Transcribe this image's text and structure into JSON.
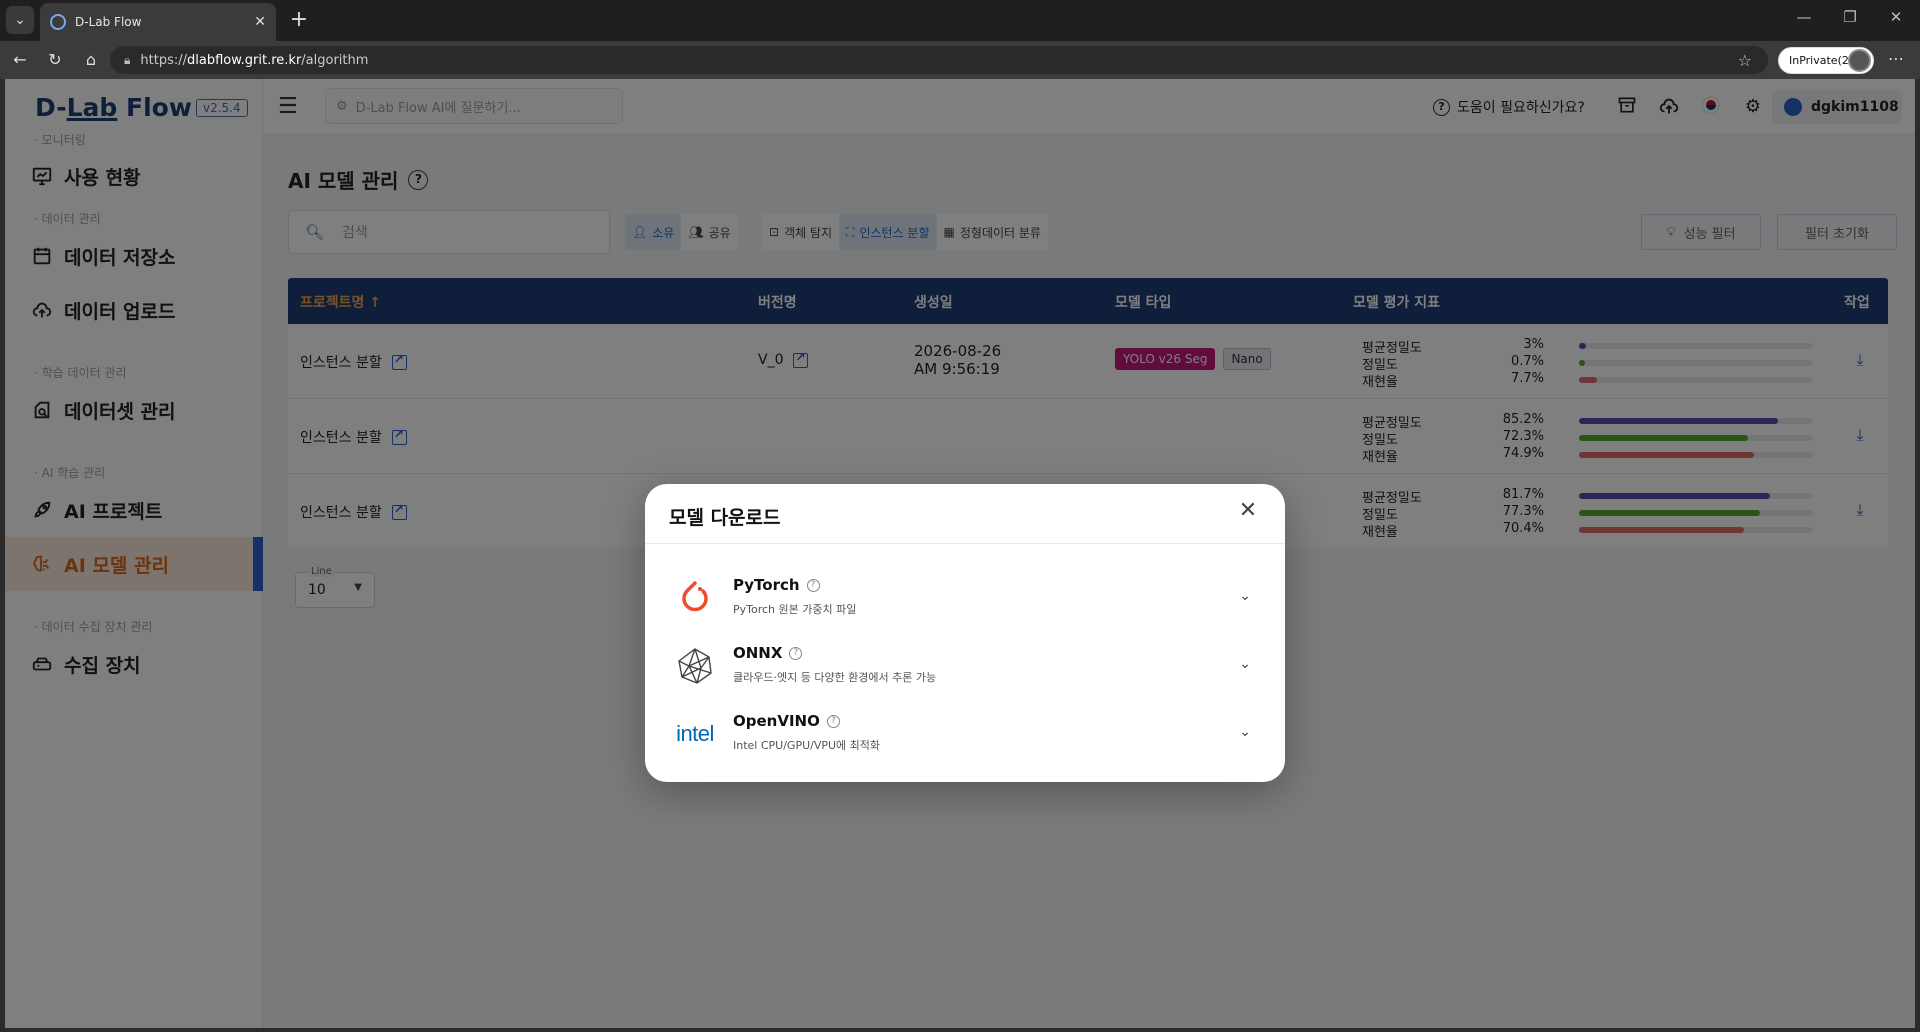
{
  "browser": {
    "tab_title": "D-Lab Flow",
    "url_scheme": "https://",
    "url_host": "dlabflow.grit.re.kr",
    "url_path": "/algorithm",
    "inprivate_label": "InPrivate(2)"
  },
  "app": {
    "logo": {
      "part1": "D-",
      "part2": "Lab",
      "part3": " Flow"
    },
    "version": "v2.5.4",
    "ai_ask_placeholder": "D-Lab Flow AI에 질문하기...",
    "help_label": "도움이 필요하신가요?",
    "username": "dgkim1108"
  },
  "sidebar": {
    "sections": [
      {
        "label": "· 모니터링"
      },
      {
        "label": "· 데이터 관리"
      },
      {
        "label": "· 학습 데이터 관리"
      },
      {
        "label": "· AI 학습 관리"
      },
      {
        "label": "· 데이터 수집 장치 관리"
      }
    ],
    "items": [
      {
        "label": "사용 현황",
        "icon": "monitor-chart-icon"
      },
      {
        "label": "데이터 저장소",
        "icon": "calendar-storage-icon"
      },
      {
        "label": "데이터 업로드",
        "icon": "cloud-upload-icon"
      },
      {
        "label": "데이터셋 관리",
        "icon": "dataset-icon"
      },
      {
        "label": "AI 프로젝트",
        "icon": "rocket-icon"
      },
      {
        "label": "AI 모델 관리",
        "icon": "brain-icon",
        "active": true
      },
      {
        "label": "수집 장치",
        "icon": "device-icon"
      }
    ]
  },
  "page": {
    "title": "AI 모델 관리",
    "search_placeholder": "검색",
    "filters_owner": [
      {
        "label": "소유",
        "active": true
      },
      {
        "label": "공유",
        "active": false
      }
    ],
    "filters_task": [
      {
        "label": "객체 탐지",
        "active": false
      },
      {
        "label": "인스턴스 분할",
        "active": true
      },
      {
        "label": "정형데이터 분류",
        "active": false
      }
    ],
    "perf_filter_label": "성능 필터",
    "reset_filter_label": "필터 초기화"
  },
  "table": {
    "headers": {
      "project": "프로젝트명 ↑",
      "version": "버전명",
      "created": "생성일",
      "model_type": "모델 타입",
      "metrics": "모델 평가 지표",
      "action": "작업"
    },
    "rows": [
      {
        "project": "인스턴스 분할",
        "version": "V_0",
        "created_date": "2026-08-26",
        "created_time": "AM 9:56:19",
        "model": "YOLO v26 Seg",
        "size": "Nano",
        "metrics": [
          {
            "name": "평균정밀도",
            "value": "3%",
            "fraction": 0.03
          },
          {
            "name": "정밀도",
            "value": "0.7%",
            "fraction": 0.007
          },
          {
            "name": "재현율",
            "value": "7.7%",
            "fraction": 0.077
          }
        ]
      },
      {
        "project": "인스턴스 분할",
        "metrics": [
          {
            "name": "평균정밀도",
            "value": "85.2%",
            "fraction": 0.852
          },
          {
            "name": "정밀도",
            "value": "72.3%",
            "fraction": 0.723
          },
          {
            "name": "재현율",
            "value": "74.9%",
            "fraction": 0.749
          }
        ]
      },
      {
        "project": "인스턴스 분할",
        "metrics": [
          {
            "name": "평균정밀도",
            "value": "81.7%",
            "fraction": 0.817
          },
          {
            "name": "정밀도",
            "value": "77.3%",
            "fraction": 0.773
          },
          {
            "name": "재현율",
            "value": "70.4%",
            "fraction": 0.704
          }
        ]
      }
    ],
    "metric_colors": [
      "#5b4bb0",
      "#55a630",
      "#e06b6b"
    ]
  },
  "pagination": {
    "line_label": "Line",
    "line_value": "10"
  },
  "modal": {
    "title": "모델 다운로드",
    "formats": [
      {
        "name": "PyTorch",
        "desc": "PyTorch 원본 가중치 파일",
        "icon": "pytorch-logo-icon"
      },
      {
        "name": "ONNX",
        "desc": "클라우드·엣지 등 다양한 환경에서 추론 가능",
        "icon": "onnx-logo-icon"
      },
      {
        "name": "OpenVINO",
        "desc": "Intel CPU/GPU/VPU에 최적화",
        "icon": "intel-logo-icon",
        "logo_text": "intel"
      }
    ]
  }
}
